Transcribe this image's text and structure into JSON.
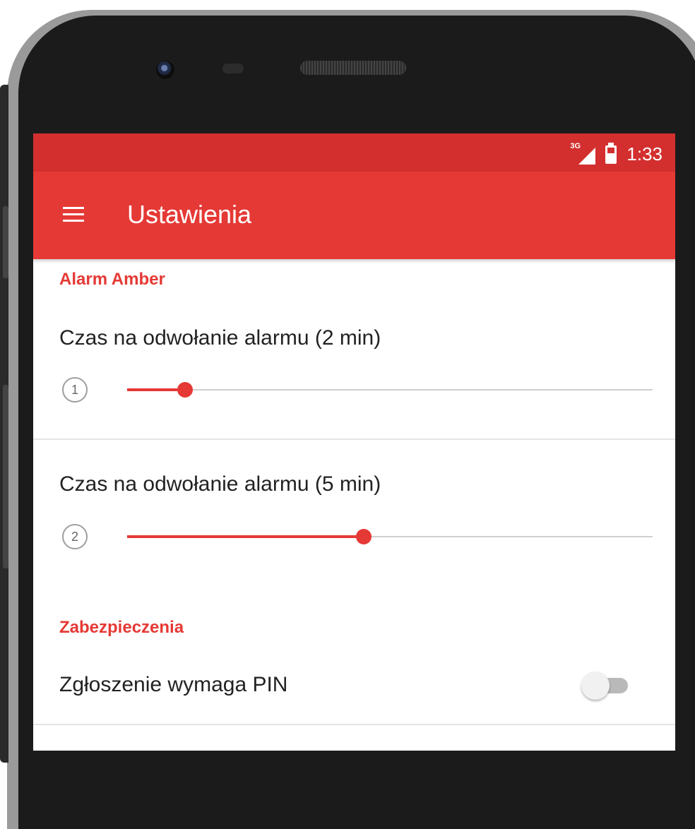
{
  "status_bar": {
    "network": "3G",
    "time": "1:33"
  },
  "app_bar": {
    "menu_icon": "menu-icon",
    "title": "Ustawienia"
  },
  "sections": [
    {
      "header": "Alarm Amber",
      "items": [
        {
          "title": "Czas na odwołanie alarmu (2 min)",
          "badge": "1",
          "slider_value_fraction": 0.11
        },
        {
          "title": "Czas na odwołanie alarmu (5 min)",
          "badge": "2",
          "slider_value_fraction": 0.45
        }
      ]
    },
    {
      "header": "Zabezpieczenia",
      "items": [
        {
          "title": "Zgłoszenie wymaga PIN",
          "switch_on": false
        }
      ]
    }
  ],
  "colors": {
    "accent": "#e53935",
    "status_bar": "#d32f2f"
  }
}
